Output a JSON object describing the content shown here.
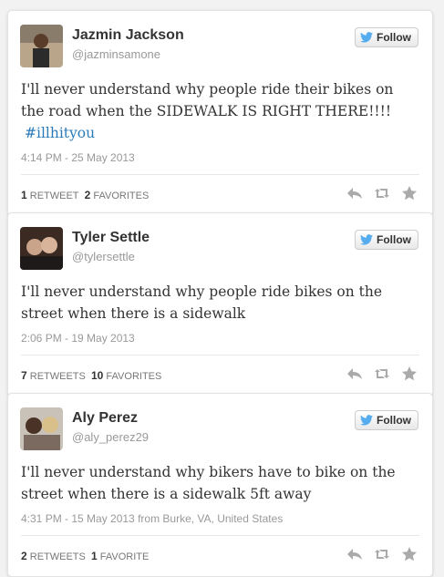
{
  "tweets": [
    {
      "name": "Jazmin Jackson",
      "handle": "@jazminsamone",
      "follow_label": "Follow",
      "text": "I'll never understand why people ride their bikes on the road when the SIDEWALK IS RIGHT THERE!!!!",
      "hashtag": "#illhityou",
      "time": "4:14 PM - 25 May 2013",
      "retweets": "1",
      "retweets_label": "RETWEET",
      "favorites": "2",
      "favorites_label": "FAVORITES"
    },
    {
      "name": "Tyler Settle",
      "handle": "@tylersettle",
      "follow_label": "Follow",
      "text": "I'll never understand why people ride bikes on the street when there is a sidewalk",
      "time": "2:06 PM - 19 May 2013",
      "retweets": "7",
      "retweets_label": "RETWEETS",
      "favorites": "10",
      "favorites_label": "FAVORITES"
    },
    {
      "name": "Aly Perez",
      "handle": "@aly_perez29",
      "follow_label": "Follow",
      "text": "I'll never understand why bikers have to bike on the street when there is a sidewalk 5ft away",
      "time": "4:31 PM - 15 May 2013 from Burke, VA, United States",
      "retweets": "2",
      "retweets_label": "RETWEETS",
      "favorites": "1",
      "favorites_label": "FAVORITE"
    }
  ],
  "icons": [
    "twitter-bird-icon",
    "reply-icon",
    "retweet-icon",
    "favorite-star-icon"
  ],
  "colors": {
    "hashtag": "#2b7bb9",
    "bird": "#55acee",
    "action_icons": "#aaaaaa"
  }
}
